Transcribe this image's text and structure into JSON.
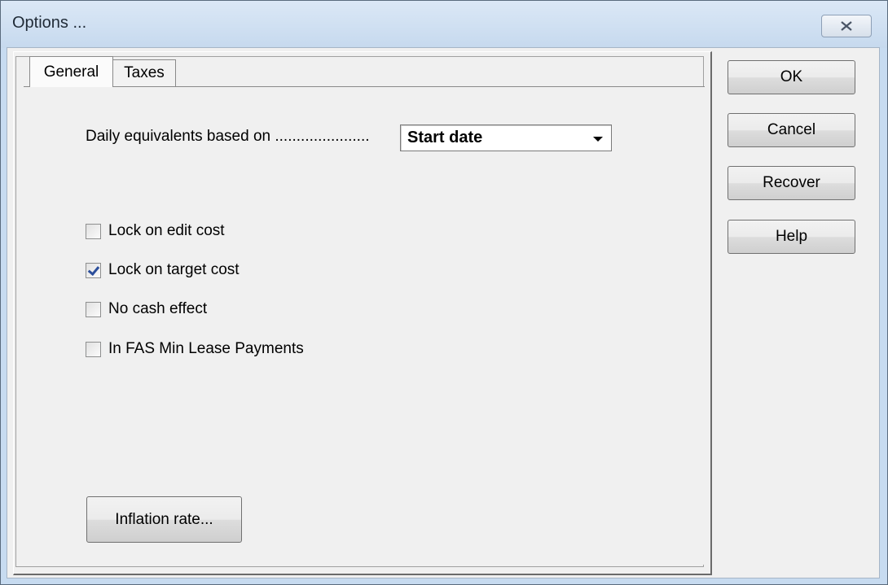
{
  "window": {
    "title": "Options ...",
    "close_icon": "close-icon"
  },
  "tabs": [
    {
      "label": "General",
      "active": true
    },
    {
      "label": "Taxes",
      "active": false
    }
  ],
  "general": {
    "daily_label": "Daily equivalents based on ......................",
    "daily_select": {
      "value": "Start date",
      "icon": "chevron-down-icon"
    },
    "checkboxes": [
      {
        "label": "Lock on edit cost",
        "checked": false
      },
      {
        "label": "Lock on target cost",
        "checked": true
      },
      {
        "label": "No cash effect",
        "checked": false
      },
      {
        "label": "In FAS Min Lease Payments",
        "checked": false
      }
    ],
    "inflation_button": "Inflation rate..."
  },
  "buttons": {
    "ok": "OK",
    "cancel": "Cancel",
    "recover": "Recover",
    "help": "Help"
  },
  "colors": {
    "titlebar": "#c6d9ee",
    "checkmark": "#2b4e9b"
  }
}
